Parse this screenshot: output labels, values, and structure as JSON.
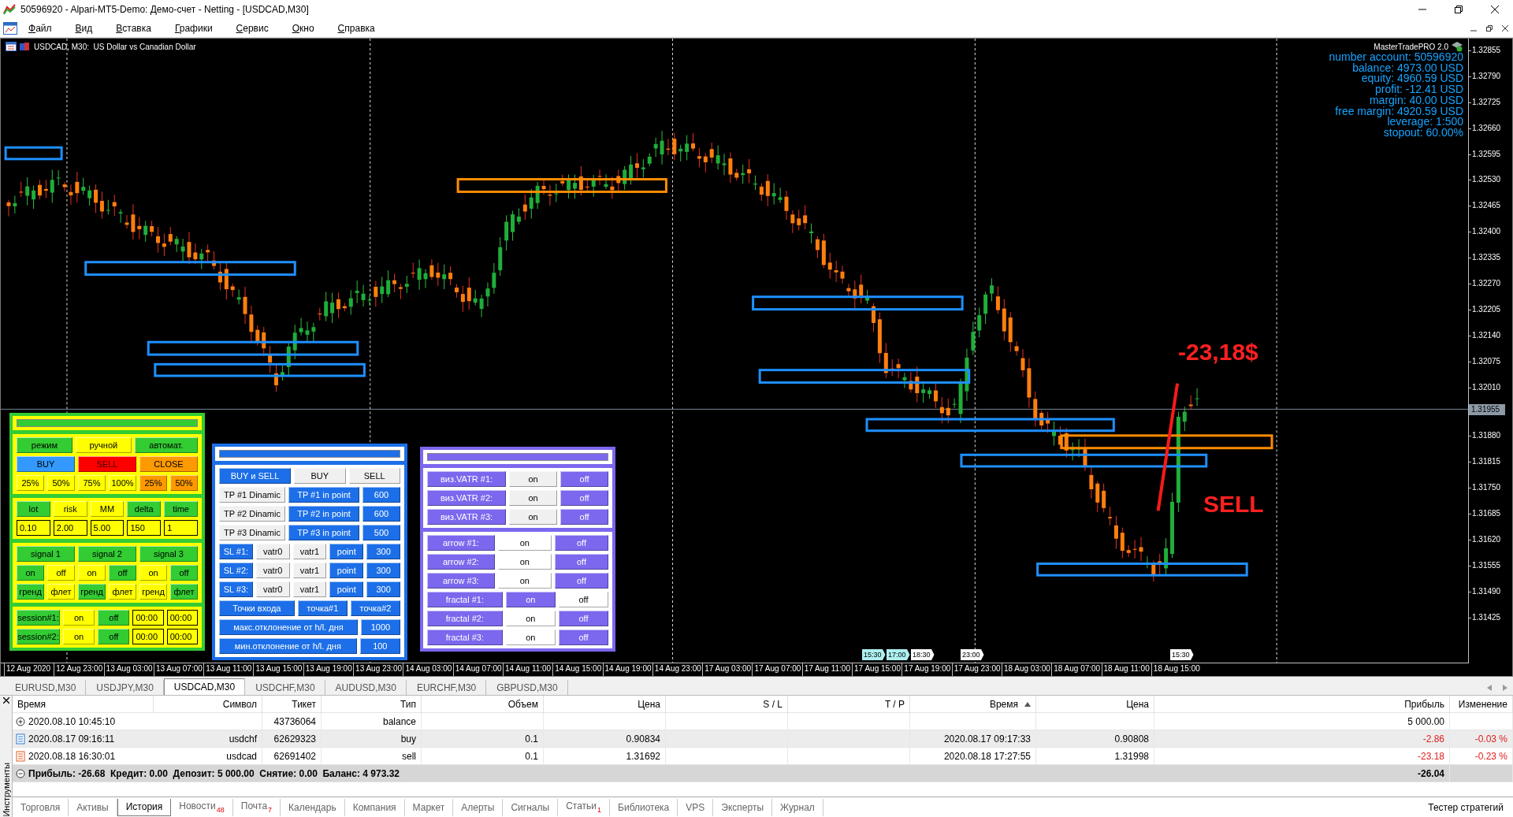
{
  "window": {
    "title": "50596920 - Alpari-MT5-Demo: Демо-счет - Netting - [USDCAD,M30]"
  },
  "menu": [
    "Файл",
    "Вид",
    "Вставка",
    "Графики",
    "Сервис",
    "Окно",
    "Справка"
  ],
  "chart": {
    "caption": "USDCAD, M30:  US Dollar vs Canadian Dollar",
    "price_labels_above": [
      "1.32855",
      "1.32790",
      "1.32725",
      "1.32660",
      "1.32595",
      "1.32530",
      "1.32465",
      "1.32400",
      "1.32335",
      "1.32270",
      "1.32205",
      "1.32140",
      "1.32075",
      "1.32010"
    ],
    "current_price": "1.31955",
    "price_labels_below": [
      "1.31880",
      "1.31815",
      "1.31750",
      "1.31685",
      "1.31620",
      "1.31555",
      "1.31490",
      "1.31425"
    ],
    "time_labels": [
      "12 Aug 2020",
      "12 Aug 23:00",
      "13 Aug 03:00",
      "13 Aug 07:00",
      "13 Aug 11:00",
      "13 Aug 15:00",
      "13 Aug 19:00",
      "13 Aug 23:00",
      "14 Aug 03:00",
      "14 Aug 07:00",
      "14 Aug 11:00",
      "14 Aug 15:00",
      "14 Aug 19:00",
      "14 Aug 23:00",
      "17 Aug 03:00",
      "17 Aug 07:00",
      "17 Aug 11:00",
      "17 Aug 15:00",
      "17 Aug 19:00",
      "17 Aug 23:00",
      "18 Aug 03:00",
      "18 Aug 07:00",
      "18 Aug 11:00",
      "18 Aug 15:00"
    ],
    "session_tags": [
      {
        "label": "15:30",
        "highlighted": true
      },
      {
        "label": "17:00",
        "highlighted": true
      },
      {
        "label": "18:30",
        "highlighted": false
      },
      {
        "label": "23:00",
        "highlighted": false
      },
      {
        "label": "15:30",
        "highlighted": false
      }
    ],
    "trade_result": "-23,18$",
    "trade_signal": "SELL"
  },
  "account": {
    "brand": "MasterTradePRO 2.0",
    "lines": [
      "number account: 50596920",
      "balance: 4973.00 USD",
      "equity: 4960.59 USD",
      "profit: -12.41 USD",
      "margin: 40.00 USD",
      "free margin: 4920.59 USD",
      "leverage: 1:500",
      "stopout: 60.00%"
    ]
  },
  "panels": [
    {
      "color": "#33cc33",
      "sections": [
        {
          "kind": "header",
          "color": "#ffff00"
        },
        {
          "kind": "rows",
          "color": "#ffff00",
          "rows": [
            [
              {
                "label": "режим",
                "color": "#33cc33"
              },
              {
                "label": "ручной",
                "color": "#ffff00"
              },
              {
                "label": "автомат.",
                "color": "#33cc33"
              }
            ],
            [
              {
                "label": "BUY",
                "color": "#3399ff"
              },
              {
                "label": "SELL",
                "color": "#ff0000"
              },
              {
                "label": "CLOSE",
                "color": "#ff9900"
              }
            ],
            [
              {
                "label": "25%",
                "color": "#ffff00"
              },
              {
                "label": "50%",
                "color": "#ffff00"
              },
              {
                "label": "75%",
                "color": "#ffff00"
              },
              {
                "label": "100%",
                "color": "#ffff00"
              },
              {
                "label": "25%",
                "color": "#ff9900"
              },
              {
                "label": "50%",
                "color": "#ff9900"
              }
            ]
          ]
        },
        {
          "kind": "rows",
          "color": "#ffff00",
          "rows": [
            [
              {
                "label": "lot",
                "color": "#33cc33"
              },
              {
                "label": "risk",
                "color": "#ffff00"
              },
              {
                "label": "MM",
                "color": "#ffff00"
              },
              {
                "label": "delta",
                "color": "#33cc33"
              },
              {
                "label": "time",
                "color": "#33cc33"
              }
            ],
            [
              {
                "kind": "input",
                "value": "0.10"
              },
              {
                "kind": "input",
                "value": "2.00"
              },
              {
                "kind": "input",
                "value": "5.00"
              },
              {
                "kind": "input",
                "value": "150"
              },
              {
                "kind": "input",
                "value": "1"
              }
            ]
          ]
        },
        {
          "kind": "rows",
          "color": "#ffff00",
          "rows": [
            [
              {
                "label": "signal 1",
                "color": "#33cc33"
              },
              {
                "label": "signal 2",
                "color": "#33cc33"
              },
              {
                "label": "signal 3",
                "color": "#33cc33"
              }
            ],
            [
              {
                "label": "on",
                "color": "#33cc33"
              },
              {
                "label": "off",
                "color": "#ffff00"
              },
              {
                "label": "on",
                "color": "#ffff00"
              },
              {
                "label": "off",
                "color": "#33cc33"
              },
              {
                "label": "on",
                "color": "#ffff00"
              },
              {
                "label": "off",
                "color": "#33cc33"
              }
            ],
            [
              {
                "label": "гренд",
                "color": "#33cc33"
              },
              {
                "label": "флет",
                "color": "#ffff00"
              },
              {
                "label": "гренд",
                "color": "#33cc33"
              },
              {
                "label": "флет",
                "color": "#ffff00"
              },
              {
                "label": "гренд",
                "color": "#ffff00"
              },
              {
                "label": "флет",
                "color": "#33cc33"
              }
            ]
          ]
        },
        {
          "kind": "rows",
          "color": "#ffff00",
          "rows": [
            [
              {
                "label": "session#1:",
                "color": "#33cc33"
              },
              {
                "label": "on",
                "color": "#ffff00"
              },
              {
                "label": "off",
                "color": "#33cc33"
              },
              {
                "kind": "input",
                "value": "00:00"
              },
              {
                "kind": "input",
                "value": "00:00"
              }
            ],
            [
              {
                "label": "session#2:",
                "color": "#33cc33"
              },
              {
                "label": "on",
                "color": "#ffff00"
              },
              {
                "label": "off",
                "color": "#33cc33"
              },
              {
                "kind": "input",
                "value": "00:00"
              },
              {
                "kind": "input",
                "value": "00:00"
              }
            ]
          ]
        }
      ]
    },
    {
      "color": "#1c6fe8",
      "sections": [
        {
          "kind": "header",
          "color": "#ffffff"
        },
        {
          "kind": "rows",
          "color": "#ffffff",
          "rows": [
            [
              {
                "label": "BUY и SELL",
                "color": "#1c6fe8"
              },
              {
                "label": "BUY",
                "color": "#f0f0f0"
              },
              {
                "label": "SELL",
                "color": "#f0f0f0"
              }
            ],
            [
              {
                "label": "TP #1 Dinamic",
                "color": "#f0f0f0"
              },
              {
                "label": "TP #1 in point",
                "color": "#1c6fe8"
              },
              {
                "label": "600",
                "color": "#1c6fe8"
              }
            ],
            [
              {
                "label": "TP #2 Dinamic",
                "color": "#f0f0f0"
              },
              {
                "label": "TP #2 in point",
                "color": "#1c6fe8"
              },
              {
                "label": "600",
                "color": "#1c6fe8"
              }
            ],
            [
              {
                "label": "TP #3 Dinamic",
                "color": "#f0f0f0"
              },
              {
                "label": "TP #3 in point",
                "color": "#1c6fe8"
              },
              {
                "label": "500",
                "color": "#1c6fe8"
              }
            ],
            [
              {
                "label": "SL #1:",
                "color": "#1c6fe8"
              },
              {
                "label": "vatr0",
                "color": "#f0f0f0"
              },
              {
                "label": "vatr1",
                "color": "#f0f0f0"
              },
              {
                "label": "point",
                "color": "#1c6fe8"
              },
              {
                "label": "300",
                "color": "#1c6fe8"
              }
            ],
            [
              {
                "label": "SL #2:",
                "color": "#1c6fe8"
              },
              {
                "label": "vatr0",
                "color": "#f0f0f0"
              },
              {
                "label": "vatr1",
                "color": "#f0f0f0"
              },
              {
                "label": "point",
                "color": "#1c6fe8"
              },
              {
                "label": "300",
                "color": "#1c6fe8"
              }
            ],
            [
              {
                "label": "SL #3:",
                "color": "#1c6fe8"
              },
              {
                "label": "vatr0",
                "color": "#f0f0f0"
              },
              {
                "label": "vatr1",
                "color": "#f0f0f0"
              },
              {
                "label": "point",
                "color": "#1c6fe8"
              },
              {
                "label": "300",
                "color": "#1c6fe8"
              }
            ],
            [
              {
                "label": "Точки входа",
                "color": "#1c6fe8"
              },
              {
                "label": "точка#1",
                "color": "#1c6fe8"
              },
              {
                "label": "точка#2",
                "color": "#1c6fe8"
              }
            ],
            [
              {
                "label": "макс.отклонение от h/l. дня",
                "color": "#1c6fe8"
              },
              {
                "label": "1000",
                "color": "#1c6fe8"
              }
            ],
            [
              {
                "label": "мин.отклонение от h/l. дня",
                "color": "#1c6fe8"
              },
              {
                "label": "100",
                "color": "#1c6fe8"
              }
            ]
          ]
        }
      ]
    },
    {
      "color": "#7b68ee",
      "sections": [
        {
          "kind": "header",
          "color": "#ffffff"
        },
        {
          "kind": "rows",
          "color": "#ffffff",
          "rows": [
            [
              {
                "label": "виз.VATR #1:",
                "color": "#7b68ee"
              },
              {
                "label": "on",
                "color": "#f0f0f0"
              },
              {
                "label": "off",
                "color": "#7b68ee"
              }
            ],
            [
              {
                "label": "виз.VATR #2:",
                "color": "#7b68ee"
              },
              {
                "label": "on",
                "color": "#f0f0f0"
              },
              {
                "label": "off",
                "color": "#7b68ee"
              }
            ],
            [
              {
                "label": "виз.VATR #3:",
                "color": "#7b68ee"
              },
              {
                "label": "on",
                "color": "#f0f0f0"
              },
              {
                "label": "off",
                "color": "#7b68ee"
              }
            ]
          ]
        },
        {
          "kind": "rows",
          "color": "#ffffff",
          "rows": [
            [
              {
                "label": "arrow #1:",
                "color": "#7b68ee"
              },
              {
                "label": "on",
                "color": "#ffffff"
              },
              {
                "label": "off",
                "color": "#7b68ee"
              }
            ],
            [
              {
                "label": "arrow #2:",
                "color": "#7b68ee"
              },
              {
                "label": "on",
                "color": "#ffffff"
              },
              {
                "label": "off",
                "color": "#7b68ee"
              }
            ],
            [
              {
                "label": "arrow #3:",
                "color": "#7b68ee"
              },
              {
                "label": "on",
                "color": "#ffffff"
              },
              {
                "label": "off",
                "color": "#7b68ee"
              }
            ],
            [
              {
                "label": "fractal #1:",
                "color": "#7b68ee"
              },
              {
                "label": "on",
                "color": "#7b68ee"
              },
              {
                "label": "off",
                "color": "#ffffff"
              }
            ],
            [
              {
                "label": "fractal #2:",
                "color": "#7b68ee"
              },
              {
                "label": "on",
                "color": "#ffffff"
              },
              {
                "label": "off",
                "color": "#7b68ee"
              }
            ],
            [
              {
                "label": "fractal #3:",
                "color": "#7b68ee"
              },
              {
                "label": "on",
                "color": "#ffffff"
              },
              {
                "label": "off",
                "color": "#7b68ee"
              }
            ]
          ]
        }
      ]
    }
  ],
  "symbol_tabs": [
    {
      "label": "EURUSD,M30",
      "selected": false
    },
    {
      "label": "USDJPY,M30",
      "selected": false
    },
    {
      "label": "USDCAD,M30",
      "selected": true
    },
    {
      "label": "USDCHF,M30",
      "selected": false
    },
    {
      "label": "AUDUSD,M30",
      "selected": false
    },
    {
      "label": "EURCHF,M30",
      "selected": false
    },
    {
      "label": "GBPUSD,M30",
      "selected": false
    }
  ],
  "toolbox": {
    "side_label": "Инструменты",
    "columns": [
      {
        "label": "Время",
        "sorted": false
      },
      {
        "label": "Символ",
        "sorted": false
      },
      {
        "label": "Тикет",
        "sorted": false
      },
      {
        "label": "Тип",
        "sorted": false
      },
      {
        "label": "Объем",
        "sorted": false
      },
      {
        "label": "Цена",
        "sorted": false
      },
      {
        "label": "S / L",
        "sorted": false
      },
      {
        "label": "T / P",
        "sorted": false
      },
      {
        "label": "Время",
        "sorted": true
      },
      {
        "label": "Цена",
        "sorted": false
      },
      {
        "label": "Прибыль",
        "sorted": false
      },
      {
        "label": "Изменение",
        "sorted": false
      }
    ],
    "rows": [
      {
        "kind": "balance",
        "loss": false,
        "time": "2020.08.10 10:45:10",
        "ticket": "43736064",
        "type": "balance",
        "profit": "5 000.00"
      },
      {
        "kind": "buy",
        "loss": true,
        "time": "2020.08.17 09:16:11",
        "symbol": "usdchf",
        "ticket": "62629323",
        "type": "buy",
        "volume": "0.1",
        "price": "0.90834",
        "close_time": "2020.08.17 09:17:33",
        "close_price": "0.90808",
        "profit": "-2.86",
        "change": "-0.03 %"
      },
      {
        "kind": "sell",
        "loss": true,
        "time": "2020.08.18 16:30:01",
        "symbol": "usdcad",
        "ticket": "62691402",
        "type": "sell",
        "volume": "0.1",
        "price": "1.31692",
        "close_time": "2020.08.18 17:27:55",
        "close_price": "1.31998",
        "profit": "-23.18",
        "change": "-0.23 %"
      }
    ],
    "total": {
      "summary": "Прибыль: -26.68  Кредит: 0.00  Депозит: 5 000.00  Снятие: 0.00  Баланс: 4 973.32",
      "profit": "-26.04"
    },
    "tabs": [
      {
        "label": "Торговля",
        "selected": false
      },
      {
        "label": "Активы",
        "selected": false
      },
      {
        "label": "История",
        "selected": true
      },
      {
        "label": "Новости",
        "badge": "48",
        "selected": false
      },
      {
        "label": "Почта",
        "badge": "7",
        "selected": false
      },
      {
        "label": "Календарь",
        "selected": false
      },
      {
        "label": "Компания",
        "selected": false
      },
      {
        "label": "Маркет",
        "selected": false
      },
      {
        "label": "Алерты",
        "selected": false
      },
      {
        "label": "Сигналы",
        "selected": false
      },
      {
        "label": "Статьи",
        "badge": "1",
        "selected": false
      },
      {
        "label": "Библиотека",
        "selected": false
      },
      {
        "label": "VPS",
        "selected": false
      },
      {
        "label": "Эксперты",
        "selected": false
      },
      {
        "label": "Журнал",
        "selected": false
      }
    ],
    "tester": "Тестер стратегий"
  }
}
